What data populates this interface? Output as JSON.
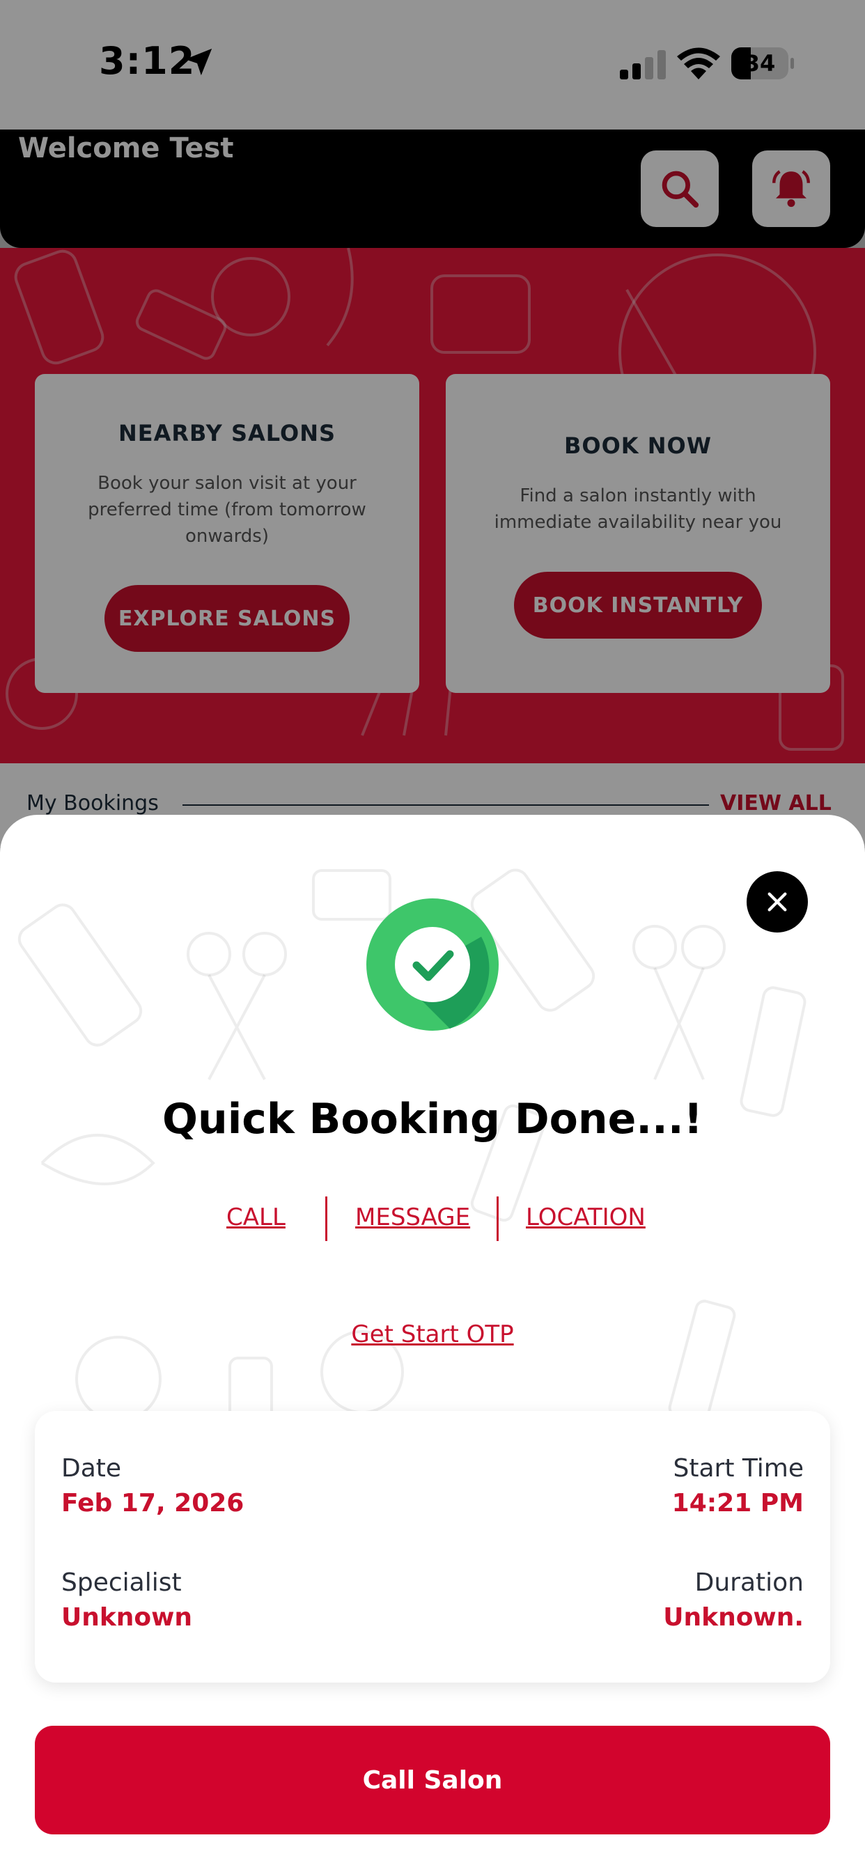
{
  "status_bar": {
    "time": "3:12",
    "battery_level": "34",
    "battery_fraction": 0.34
  },
  "header": {
    "welcome": "Welcome Test",
    "search_icon": "search-icon",
    "bell_icon": "bell-icon"
  },
  "cards": [
    {
      "title": "NEARBY SALONS",
      "description": "Book your salon visit at your preferred time (from tomorrow onwards)",
      "button": "EXPLORE SALONS"
    },
    {
      "title": "BOOK NOW",
      "description": "Find a salon instantly with immediate availability near you",
      "button": "BOOK INSTANTLY"
    }
  ],
  "bookings": {
    "label": "My Bookings",
    "view_all": "VIEW ALL"
  },
  "sheet": {
    "title": "Quick Booking Done...!",
    "links": [
      "CALL",
      "MESSAGE",
      "LOCATION"
    ],
    "otp_link": "Get Start OTP",
    "details": {
      "date_label": "Date",
      "date_value": "Feb 17, 2026",
      "start_time_label": "Start Time",
      "start_time_value": "14:21 PM",
      "specialist_label": "Specialist",
      "specialist_value": "Unknown",
      "duration_label": "Duration",
      "duration_value": "Unknown."
    },
    "call_button": "Call Salon"
  },
  "colors": {
    "brand_red": "#c8102e",
    "hero_red": "#e8173c",
    "success_green": "#3ec66a",
    "success_dark": "#1e9e58"
  }
}
